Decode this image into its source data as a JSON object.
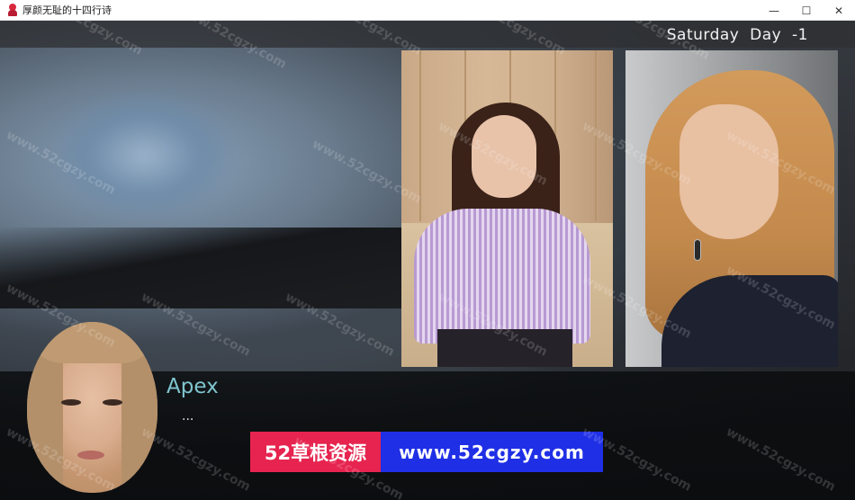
{
  "window": {
    "title": "厚颜无耻的十四行诗",
    "controls": {
      "minimize": "—",
      "maximize": "☐",
      "close": "✕"
    }
  },
  "hud": {
    "day_label": "Saturday  Day  -1"
  },
  "dialogue": {
    "speaker": "Apex",
    "text": "..."
  },
  "banner": {
    "left_text": "52草根资源",
    "right_text": "www.52cgzy.com"
  },
  "watermark_text": "www.52cgzy.com",
  "colors": {
    "speaker_name": "#7fc6cf",
    "banner_left_bg": "#e6244f",
    "banner_right_bg": "#1f2fe6",
    "app_icon": "#d8283e"
  }
}
